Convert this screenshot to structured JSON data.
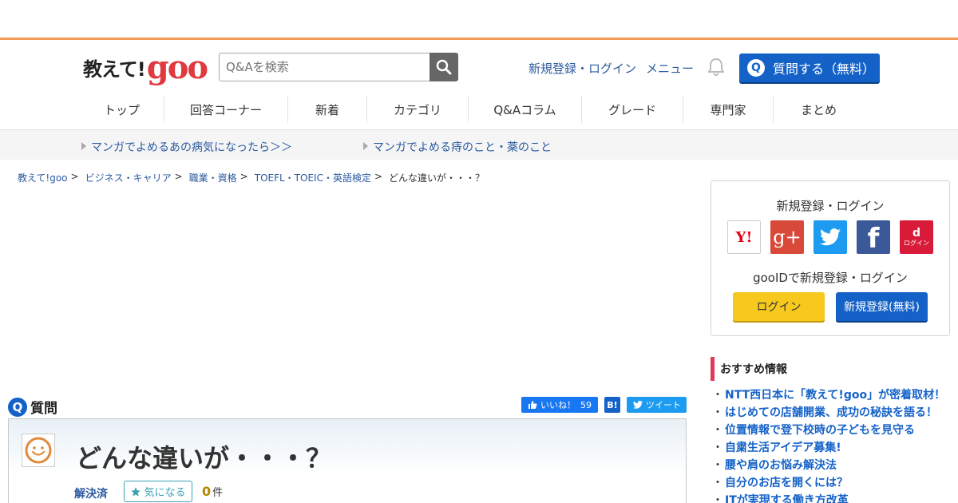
{
  "header": {
    "logo_text": "教えて!",
    "logo_goo": "goo",
    "search_placeholder": "Q&Aを検索",
    "register_login": "新規登録・ログイン",
    "menu": "メニュー",
    "ask_q": "Q",
    "ask_label": "質問する（無料）"
  },
  "nav": {
    "items": [
      {
        "label": "トップ"
      },
      {
        "label": "回答コーナー"
      },
      {
        "label": "新着"
      },
      {
        "label": "カテゴリ"
      },
      {
        "label": "Q&Aコラム"
      },
      {
        "label": "グレード"
      },
      {
        "label": "専門家"
      },
      {
        "label": "まとめ"
      }
    ]
  },
  "subbar": {
    "links": [
      {
        "label": "マンガでよめるあの病気になったら＞＞"
      },
      {
        "label": "マンガでよめる痔のこと・薬のこと"
      }
    ]
  },
  "breadcrumb": {
    "items": [
      "教えて!goo",
      "ビジネス・キャリア",
      "職業・資格",
      "TOEFL・TOEIC・英語検定"
    ],
    "separator": ">",
    "current": "どんな違いが・・・？"
  },
  "question": {
    "label_icon": "Q",
    "label": "質問",
    "title": "どんな違いが・・・？",
    "status": "解決済",
    "fav_label": "気になる",
    "fav_count": "0",
    "fav_unit": "件"
  },
  "share": {
    "like_label": "いいね！",
    "like_count": "59",
    "hatena": "B!",
    "tweet": "ツイート"
  },
  "login_box": {
    "title": "新規登録・ログイン",
    "social": {
      "yahoo": "Y!",
      "google": "g+",
      "facebook": "f",
      "docomo_mark": "d",
      "docomo_label": "ログイン"
    },
    "gooid_text": "gooIDで新規登録・ログイン",
    "login_btn": "ログイン",
    "register_btn": "新規登録(無料)"
  },
  "recommend": {
    "heading": "おすすめ情報",
    "bullet": "・",
    "items": [
      "NTT西日本に「教えて!goo」が密着取材！",
      "はじめての店舗開業、成功の秘訣を語る！",
      "位置情報で登下校時の子どもを見守る",
      "自粛生活アイデア募集!",
      "腰や肩のお悩み解決法",
      "自分のお店を開くには？",
      "ITが実現する働き方改革"
    ]
  },
  "colors": {
    "brand_blue": "#1462c8",
    "logo_red": "#e0393e",
    "accent_orange": "#f39a52",
    "login_yellow": "#f7c81e"
  }
}
